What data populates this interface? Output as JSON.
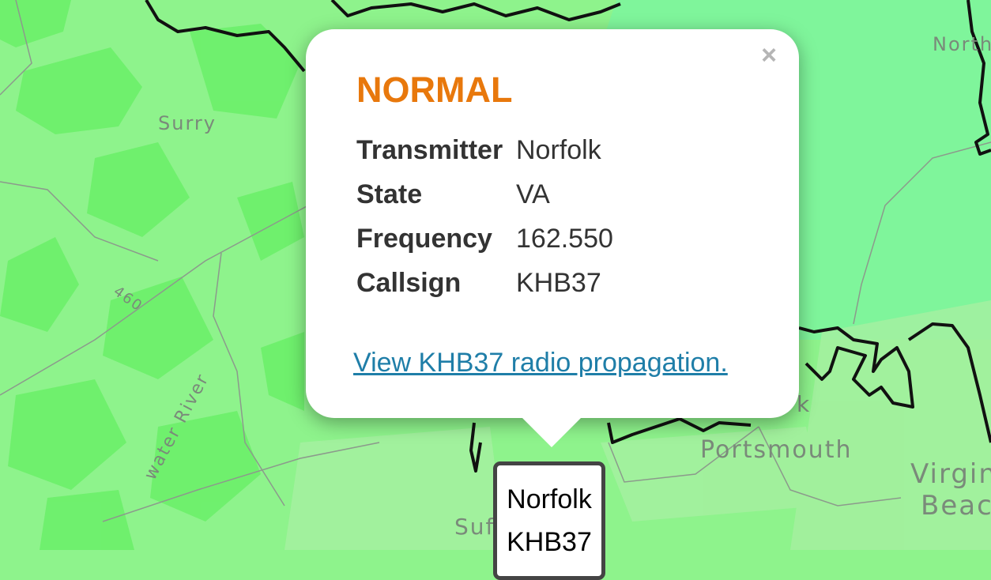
{
  "map": {
    "places": [
      "Surry",
      "Portsmouth",
      "Virgin",
      "Beac",
      "North",
      "Suf",
      "water River",
      "460",
      "k"
    ]
  },
  "popup": {
    "close_label": "×",
    "status": "NORMAL",
    "status_color": "#e8780c",
    "rows": [
      {
        "label": "Transmitter",
        "value": "Norfolk"
      },
      {
        "label": "State",
        "value": "VA"
      },
      {
        "label": "Frequency",
        "value": "162.550"
      },
      {
        "label": "Callsign",
        "value": "KHB37"
      }
    ],
    "link_text": "View KHB37 radio propagation."
  },
  "marker": {
    "line1": "Norfolk",
    "line2": "KHB37"
  }
}
